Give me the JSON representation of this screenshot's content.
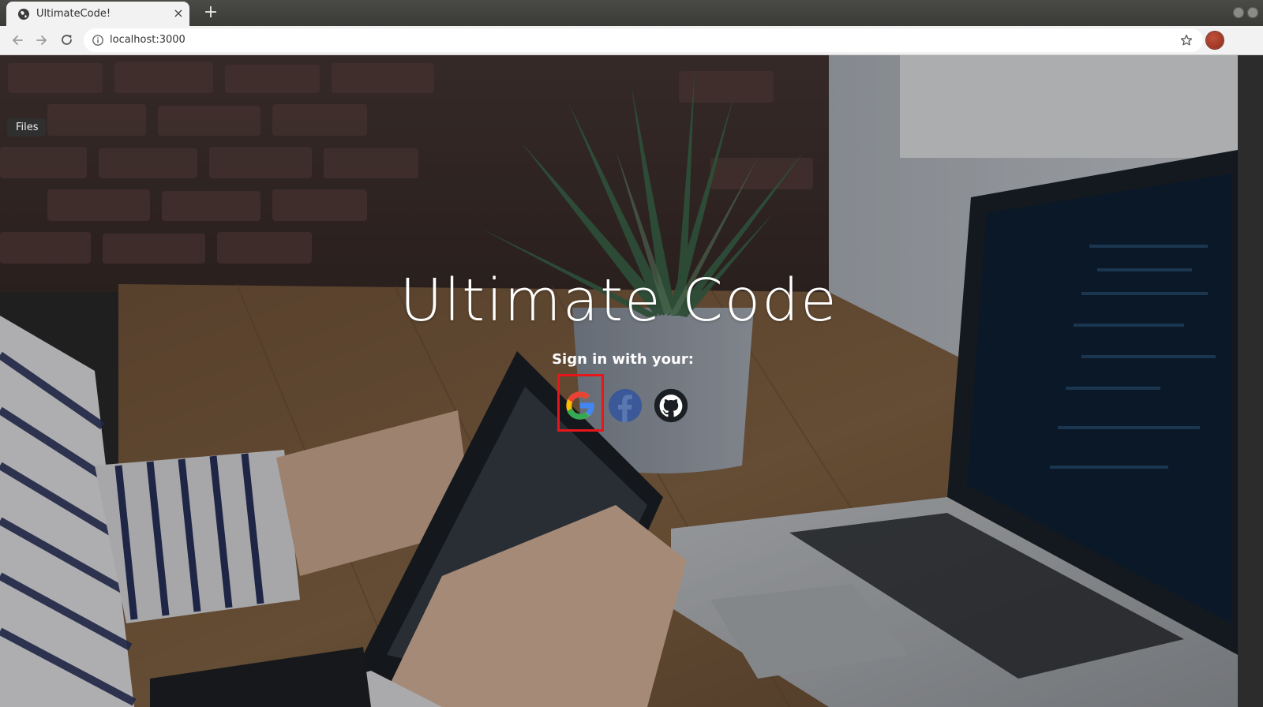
{
  "browser": {
    "tab_title": "UltimateCode!",
    "tab_close_glyph": "×",
    "new_tab_glyph": "+",
    "url": "localhost:3000",
    "icons": {
      "favicon": "globe-icon",
      "back": "back-arrow-icon",
      "forward": "forward-arrow-icon",
      "reload": "reload-icon",
      "site_info": "info-icon",
      "bookmark": "star-icon",
      "profile": "avatar"
    }
  },
  "desktop": {
    "files_tooltip": "Files"
  },
  "hero": {
    "title": "Ultimate Code",
    "signin_prompt": "Sign in with your:",
    "providers": [
      {
        "name": "google",
        "icon": "google-icon",
        "highlighted": true
      },
      {
        "name": "facebook",
        "icon": "facebook-icon",
        "highlighted": false
      },
      {
        "name": "github",
        "icon": "github-icon",
        "highlighted": false
      }
    ],
    "highlight_color": "#e8161b"
  },
  "colors": {
    "google_blue": "#4285F4",
    "google_red": "#EA4335",
    "google_yellow": "#FBBC05",
    "google_green": "#34A853",
    "facebook_blue": "#3b5998",
    "github_black": "#1b1f23"
  }
}
